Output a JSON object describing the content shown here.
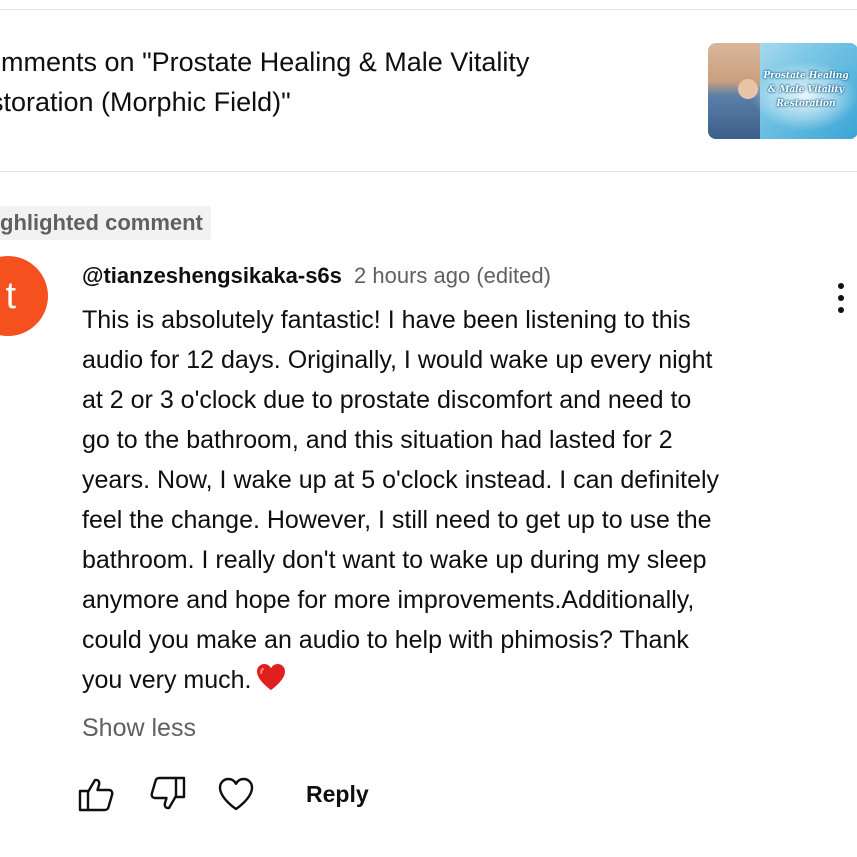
{
  "header": {
    "title_line1": "omments on \"Prostate Healing & Male Vitality",
    "title_line2": "storation (Morphic Field)\"",
    "thumbnail": {
      "line1": "Prostate Healing",
      "line2": "& Male Vitality",
      "line3": "Restoration"
    }
  },
  "comment": {
    "badge": "ghlighted comment",
    "avatar_letter": "t",
    "avatar_color": "#f4511e",
    "author": "@tianzeshengsikaka-s6s",
    "meta": "2 hours ago (edited)",
    "lines": [
      "This is absolutely fantastic! I have been listening to this",
      "audio for 12 days. Originally, I would wake up every night",
      "at 2 or 3 o'clock due to prostate discomfort and need to",
      "go to the bathroom, and this situation had lasted for 2",
      "years. Now, I wake up at 5 o'clock instead. I can definitely",
      "feel the change. However, I still need to get up to use the",
      "bathroom. I really don't want to wake up during my sleep",
      "anymore and hope for more improvements.Additionally,",
      "could you make an audio to help with phimosis? Thank",
      "you very much."
    ],
    "show_less": "Show less",
    "reply_label": "Reply"
  },
  "icons": {
    "more": "more-vert-icon",
    "like": "thumb-up-icon",
    "dislike": "thumb-down-icon",
    "heart": "heart-outline-icon",
    "emoji": "red-heart-emoji-icon"
  }
}
